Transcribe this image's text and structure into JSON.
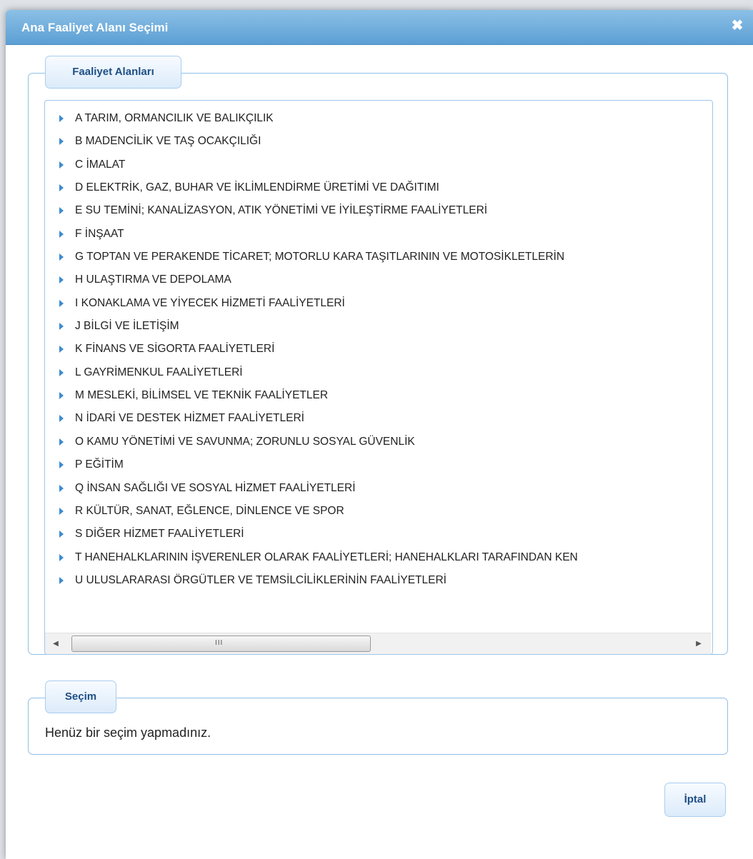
{
  "dialog": {
    "title": "Ana Faaliyet Alanı Seçimi",
    "close_icon": "close-icon",
    "close_glyph": "✖",
    "accent_color": "#5b9fd4"
  },
  "areas": {
    "legend": "Faaliyet Alanları",
    "expander_icon": "triangle-right-icon",
    "items": [
      {
        "label": "A TARIM, ORMANCILIK VE BALIKÇILIK"
      },
      {
        "label": "B MADENCİLİK VE TAŞ OCAKÇILIĞI"
      },
      {
        "label": "C İMALAT"
      },
      {
        "label": "D ELEKTRİK, GAZ, BUHAR VE İKLİMLENDİRME ÜRETİMİ VE DAĞITIMI"
      },
      {
        "label": "E SU TEMİNİ; KANALİZASYON, ATIK YÖNETİMİ VE İYİLEŞTİRME FAALİYETLERİ"
      },
      {
        "label": "F İNŞAAT"
      },
      {
        "label": "G TOPTAN VE PERAKENDE TİCARET; MOTORLU KARA TAŞITLARININ VE MOTOSİKLETLERİN"
      },
      {
        "label": "H ULAŞTIRMA VE DEPOLAMA"
      },
      {
        "label": "I KONAKLAMA VE YİYECEK HİZMETİ FAALİYETLERİ"
      },
      {
        "label": "J BİLGİ VE İLETİŞİM"
      },
      {
        "label": "K FİNANS VE SİGORTA FAALİYETLERİ"
      },
      {
        "label": "L GAYRİMENKUL FAALİYETLERİ"
      },
      {
        "label": "M MESLEKİ, BİLİMSEL VE TEKNİK FAALİYETLER"
      },
      {
        "label": "N İDARİ VE DESTEK HİZMET FAALİYETLERİ"
      },
      {
        "label": "O KAMU YÖNETİMİ VE SAVUNMA; ZORUNLU SOSYAL GÜVENLİK"
      },
      {
        "label": "P EĞİTİM"
      },
      {
        "label": "Q İNSAN SAĞLIĞI VE SOSYAL HİZMET FAALİYETLERİ"
      },
      {
        "label": "R KÜLTÜR, SANAT, EĞLENCE, DİNLENCE VE SPOR"
      },
      {
        "label": "S DİĞER HİZMET FAALİYETLERİ"
      },
      {
        "label": "T HANEHALKLARININ İŞVERENLER OLARAK FAALİYETLERİ; HANEHALKLARI TARAFINDAN KEN"
      },
      {
        "label": "U ULUSLARARASI ÖRGÜTLER VE TEMSİLCİLİKLERİNİN FAALİYETLERİ"
      }
    ],
    "scrollbar": {
      "left_arrow": "◀",
      "right_arrow": "▶",
      "grip": "III"
    }
  },
  "selection": {
    "legend": "Seçim",
    "text": "Henüz bir seçim yapmadınız."
  },
  "footer": {
    "cancel_label": "İptal"
  }
}
